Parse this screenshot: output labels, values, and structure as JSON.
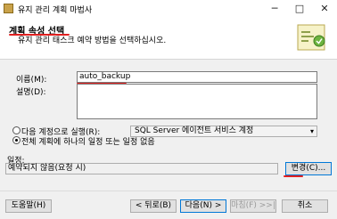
{
  "window": {
    "title": "유지 관리 계획 마법사",
    "minimize": "─",
    "maximize": "□",
    "close": "✕"
  },
  "header": {
    "title": "계획 속성 선택",
    "subtitle": "유지 관리 태스크 예약 방법을 선택하십시오."
  },
  "form": {
    "name_label": "이름(M):",
    "name_value": "auto_backup",
    "description_label": "설명(D):",
    "run_as_label": "다음 계정으로 실행(R):",
    "run_as_value": "SQL Server 에이전트 서비스 계정",
    "radio_option": "전체 계획에 하나의 일정 또는 일정 없음",
    "schedule_label": "일정:",
    "schedule_value": "예약되지 않음(요청 시)",
    "change_button": "변경(C)..."
  },
  "footer": {
    "help": "도움말(H)",
    "back": "< 뒤로(B)",
    "next": "다음(N) >",
    "finish": "마침(F) >>|",
    "cancel": "취소"
  },
  "colors": {
    "annotation": "#e02020",
    "focus": "#0078d7"
  }
}
